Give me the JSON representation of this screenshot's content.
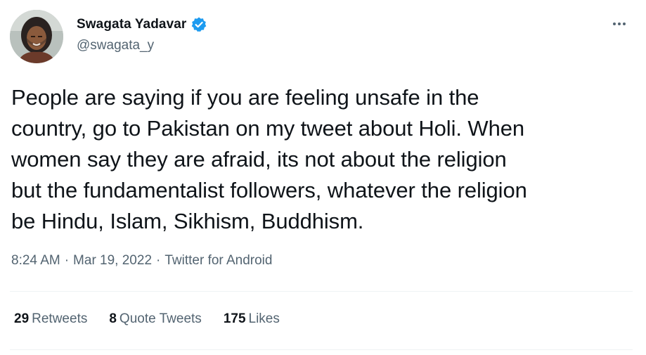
{
  "author": {
    "display_name": "Swagata Yadavar",
    "handle": "@swagata_y",
    "verified_icon": "verified-badge-icon",
    "avatar_icon": "profile-photo"
  },
  "tweet": {
    "text": "People are saying if you are feeling unsafe in the\ncountry, go to Pakistan on my tweet about Holi. When\nwomen say they are afraid, its not about the religion\nbut the fundamentalist followers, whatever the religion\nbe Hindu, Islam, Sikhism, Buddhism.",
    "time": "8:24 AM",
    "separator": "·",
    "date": "Mar 19, 2022",
    "source": "Twitter for Android"
  },
  "stats": {
    "retweets_count": "29",
    "retweets_label": "Retweets",
    "quote_count": "8",
    "quote_label": "Quote Tweets",
    "likes_count": "175",
    "likes_label": "Likes"
  },
  "colors": {
    "text_primary": "#0f1419",
    "text_secondary": "#536471",
    "verified_blue": "#1d9bf0",
    "divider": "#eff3f4"
  }
}
